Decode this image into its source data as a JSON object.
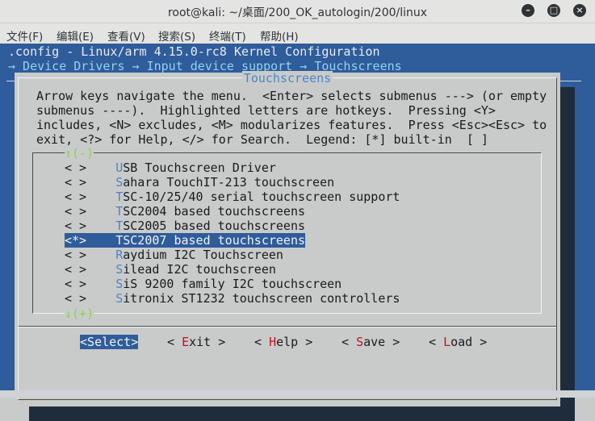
{
  "window": {
    "title": "root@kali: ~/桌面/200_OK_autologin/200/linux",
    "minimize_label": "–",
    "maximize_label": "□",
    "close_label": "×"
  },
  "menubar": {
    "items": [
      "文件(F)",
      "编辑(E)",
      "查看(V)",
      "搜索(S)",
      "终端(T)",
      "帮助(H)"
    ]
  },
  "terminal": {
    "config_line": ".config - Linux/arm 4.15.0-rc8 Kernel Configuration",
    "breadcrumb_line": "→ Device Drivers → Input device support → Touchscreens"
  },
  "dialog": {
    "title": "Touchscreens",
    "help_lines": [
      "Arrow keys navigate the menu.  <Enter> selects submenus ---> (or empty",
      "submenus ----).  Highlighted letters are hotkeys.  Pressing <Y>",
      "includes, <N> excludes, <M> modularizes features.  Press <Esc><Esc> to",
      "exit, <?> for Help, </> for Search.  Legend: [*] built-in  [ ]"
    ],
    "scroll_up": "↑(-)",
    "scroll_down": "↓(+)",
    "items": [
      {
        "state": "< >",
        "hotkey": "U",
        "rest": "SB Touchscreen Driver"
      },
      {
        "state": "< >",
        "hotkey": "S",
        "rest": "ahara TouchIT-213 touchscreen"
      },
      {
        "state": "< >",
        "hotkey": "T",
        "rest": "SC-10/25/40 serial touchscreen support"
      },
      {
        "state": "< >",
        "hotkey": "T",
        "rest": "SC2004 based touchscreens"
      },
      {
        "state": "< >",
        "hotkey": "T",
        "rest": "SC2005 based touchscreens"
      },
      {
        "state": "<*>",
        "hotkey": "T",
        "rest": "SC2007 based touchscreens"
      },
      {
        "state": "< >",
        "hotkey": "R",
        "rest": "aydium I2C Touchscreen"
      },
      {
        "state": "< >",
        "hotkey": "S",
        "rest": "ilead I2C touchscreen"
      },
      {
        "state": "< >",
        "hotkey": "S",
        "rest": "iS 9200 family I2C touchscreen"
      },
      {
        "state": "< >",
        "hotkey": "S",
        "rest": "itronix ST1232 touchscreen controllers"
      }
    ],
    "selected_index": 5,
    "buttons": [
      {
        "open": "<",
        "hotkey": "S",
        "rest": "elect",
        "close": ">"
      },
      {
        "open": "< ",
        "hotkey": "E",
        "rest": "xit",
        "close": " >"
      },
      {
        "open": "< ",
        "hotkey": "H",
        "rest": "elp",
        "close": " >"
      },
      {
        "open": "< ",
        "hotkey": "S",
        "rest": "ave",
        "close": " >"
      },
      {
        "open": "< ",
        "hotkey": "L",
        "rest": "oad",
        "close": " >"
      }
    ]
  },
  "colors": {
    "terminal_bg": "#2f5c9a",
    "dialog_bg": "#c9cbcb",
    "title_blue": "#4a86c5",
    "button_hotkey_red": "#c0141c",
    "scroll_green": "#8fd14f"
  }
}
